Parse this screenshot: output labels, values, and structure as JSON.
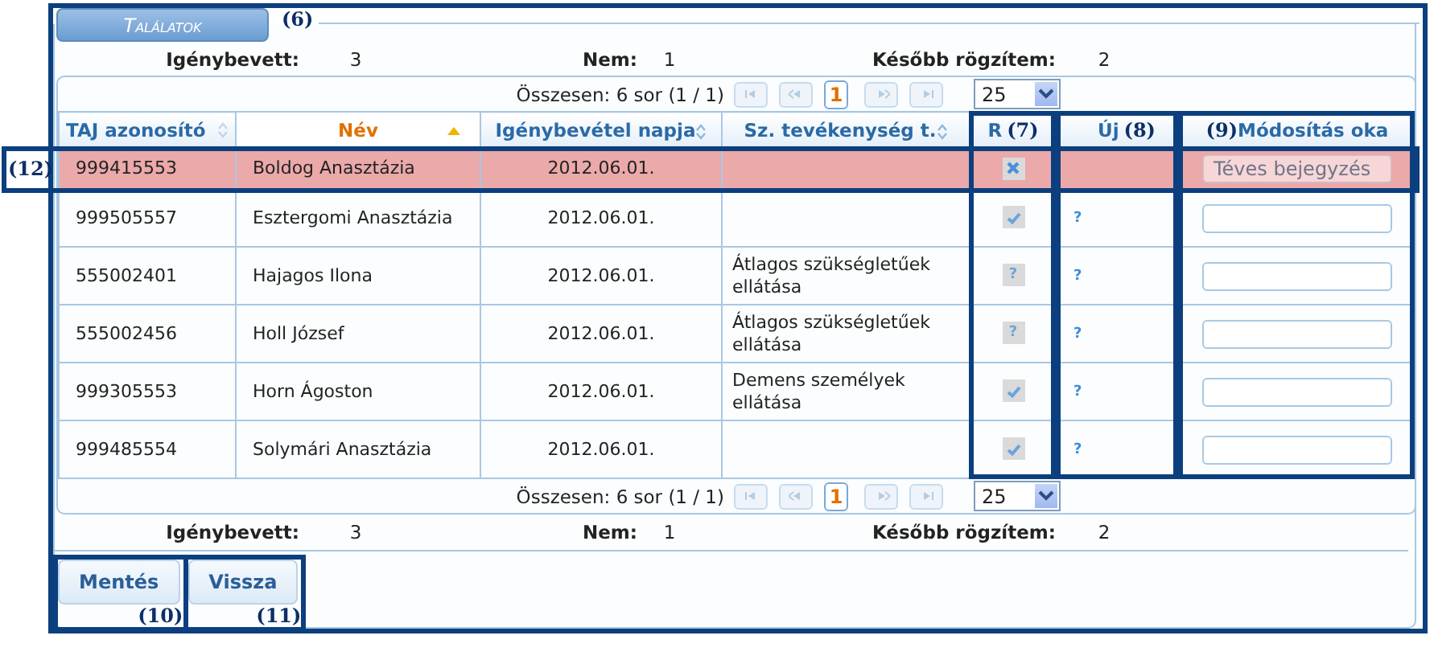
{
  "tab": {
    "label": "Találatok",
    "callout": "(6)"
  },
  "summary_top": [
    {
      "label": "Igénybevett:",
      "value": "3"
    },
    {
      "label": "Nem:",
      "value": "1"
    },
    {
      "label": "Később rögzítem:",
      "value": "2"
    }
  ],
  "pager_top": {
    "text": "Összesen: 6 sor (1 / 1)",
    "page": "1",
    "page_size": "25",
    "disabled": true
  },
  "columns": [
    {
      "label": "TAJ azonosító",
      "sortable": true,
      "sorted": false
    },
    {
      "label": "Név",
      "sortable": true,
      "sorted": true
    },
    {
      "label": "Igénybevétel napja",
      "sortable": true,
      "sorted": false
    },
    {
      "label": "Sz. tevékenység t.",
      "sortable": true,
      "sorted": false
    },
    {
      "label": "R",
      "sortable": false,
      "sorted": false,
      "callout": {
        "text": "(7)",
        "before": false
      }
    },
    {
      "label": "Új",
      "sortable": false,
      "sorted": false,
      "callout": {
        "text": "(8)",
        "before": false
      }
    },
    {
      "label": "Módosítás oka",
      "sortable": false,
      "sorted": false,
      "callout": {
        "text": "(9)",
        "before": true
      }
    }
  ],
  "rows": [
    {
      "taj": "999415553",
      "name": "Boldog Anasztázia",
      "date": "2012.06.01.",
      "r": {
        "kind": "cross"
      },
      "reason": {
        "value": "Téves bejegyzés",
        "disabled": true
      },
      "highlighted": true,
      "callout": "(12)"
    },
    {
      "taj": "999505557",
      "name": "Esztergomi Anasztázia",
      "date": "2012.06.01.",
      "r": {
        "kind": "check"
      },
      "uj": "?",
      "reason": {
        "disabled": false
      },
      "highlighted": false
    },
    {
      "taj": "555002401",
      "name": "Hajagos Ilona",
      "date": "2012.06.01.",
      "activity": "Átlagos szükségletűek ellátása",
      "r": {
        "kind": "unknown",
        "text": "?"
      },
      "uj": "?",
      "reason": {
        "disabled": false
      },
      "highlighted": false
    },
    {
      "taj": "555002456",
      "name": "Holl József",
      "date": "2012.06.01.",
      "activity": "Átlagos szükségletűek ellátása",
      "r": {
        "kind": "unknown",
        "text": "?"
      },
      "uj": "?",
      "reason": {
        "disabled": false
      },
      "highlighted": false
    },
    {
      "taj": "999305553",
      "name": "Horn Ágoston",
      "date": "2012.06.01.",
      "activity": "Demens személyek ellátása",
      "r": {
        "kind": "check"
      },
      "uj": "?",
      "reason": {
        "disabled": false
      },
      "highlighted": false
    },
    {
      "taj": "999485554",
      "name": "Solymári Anasztázia",
      "date": "2012.06.01.",
      "r": {
        "kind": "check"
      },
      "uj": "?",
      "reason": {
        "disabled": false
      },
      "highlighted": false
    }
  ],
  "pager_bottom": {
    "text": "Összesen: 6 sor (1 / 1)",
    "page": "1",
    "page_size": "25",
    "disabled": true
  },
  "summary_bottom": [
    {
      "label": "Igénybevett:",
      "value": "3"
    },
    {
      "label": "Nem:",
      "value": "1"
    },
    {
      "label": "Később rögzítem:",
      "value": "2"
    }
  ],
  "buttons": [
    {
      "label": "Mentés",
      "callout": "(10)"
    },
    {
      "label": "Vissza",
      "callout": "(11)"
    }
  ]
}
